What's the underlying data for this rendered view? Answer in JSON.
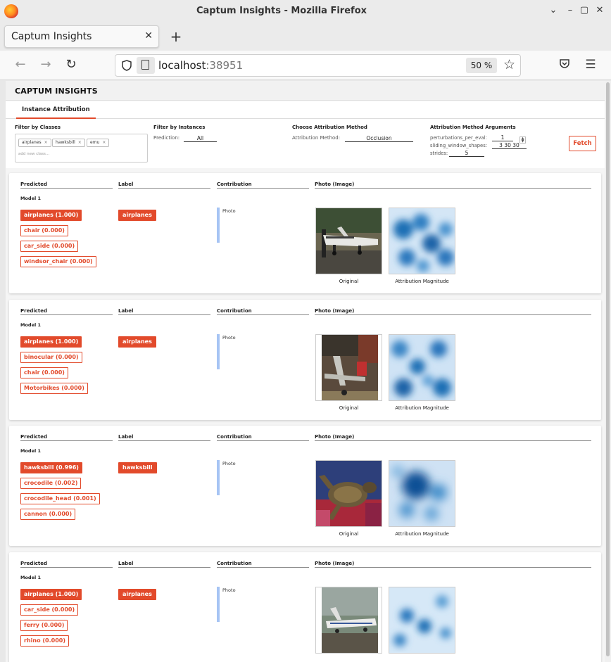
{
  "browser": {
    "window_title": "Captum Insights - Mozilla Firefox",
    "tab_title": "Captum Insights",
    "url_host": "localhost",
    "url_port": ":38951",
    "zoom": "50 %"
  },
  "app": {
    "brand": "CAPTUM INSIGHTS",
    "tab": "Instance Attribution",
    "filters": {
      "classes_title": "Filter by Classes",
      "class_chips": [
        "airplanes",
        "hawksbill",
        "emu"
      ],
      "add_class_placeholder": "add new class...",
      "instances_title": "Filter by Instances",
      "prediction_label": "Prediction:",
      "prediction_value": "All",
      "method_title": "Choose Attribution Method",
      "method_label": "Attribution Method:",
      "method_value": "Occlusion",
      "args_title": "Attribution Method Arguments",
      "args": [
        {
          "label": "perturbations_per_eval:",
          "value": "1"
        },
        {
          "label": "sliding_window_shapes:",
          "value": "3 30 30"
        },
        {
          "label": "strides:",
          "value": "5"
        }
      ],
      "fetch_label": "Fetch"
    },
    "columns": {
      "predicted": "Predicted",
      "label": "Label",
      "contribution": "Contribution",
      "photo": "Photo (Image)"
    },
    "model_name": "Model 1",
    "contribution_label": "Photo",
    "original_caption": "Original",
    "attribution_caption": "Attribution Magnitude",
    "instances": [
      {
        "predictions": [
          "airplanes (1.000)",
          "chair (0.000)",
          "car_side (0.000)",
          "windsor_chair (0.000)"
        ],
        "label": "airplanes"
      },
      {
        "predictions": [
          "airplanes (1.000)",
          "binocular (0.000)",
          "chair (0.000)",
          "Motorbikes (0.000)"
        ],
        "label": "airplanes"
      },
      {
        "predictions": [
          "hawksbill (0.996)",
          "crocodile (0.002)",
          "crocodile_head (0.001)",
          "cannon (0.000)"
        ],
        "label": "hawksbill"
      },
      {
        "predictions": [
          "airplanes (1.000)",
          "car_side (0.000)",
          "ferry (0.000)",
          "rhino (0.000)"
        ],
        "label": "airplanes"
      }
    ],
    "colors": {
      "accent": "#e24a2b",
      "contribution": "#a6c4f4",
      "heatmap": "#1f6fb5"
    }
  }
}
